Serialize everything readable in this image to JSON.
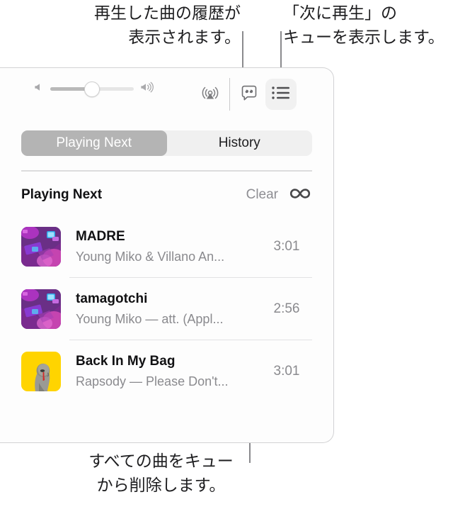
{
  "annotations": {
    "history_callout": "再生した曲の履歴が\n表示されます。",
    "queue_callout": "「次に再生」の\nキューを表示します。",
    "clear_callout": "すべての曲をキュー\nから削除します。"
  },
  "player": {
    "controls": {
      "volume_low_icon": "speaker-low-icon",
      "volume_high_icon": "speaker-high-icon",
      "volume_level_percent": 50,
      "airplay_icon": "airplay-icon",
      "lyrics_icon": "lyrics-speech-bubble-icon",
      "queue_icon": "queue-list-icon",
      "queue_active": true
    },
    "tabs": [
      {
        "label": "Playing Next",
        "active": true
      },
      {
        "label": "History",
        "active": false
      }
    ],
    "section": {
      "title": "Playing Next",
      "clear_label": "Clear",
      "autoplay_icon": "infinity-autoplay-icon"
    },
    "tracks": [
      {
        "title": "MADRE",
        "subtitle": "Young Miko & Villano An...",
        "duration": "3:01",
        "artwork": "purple-room-artwork"
      },
      {
        "title": "tamagotchi",
        "subtitle": "Young Miko — att. (Appl...",
        "duration": "2:56",
        "artwork": "purple-room-artwork"
      },
      {
        "title": "Back In My Bag",
        "subtitle": "Rapsody — Please Don't...",
        "duration": "3:01",
        "artwork": "yellow-portrait-artwork"
      }
    ]
  },
  "colors": {
    "panel_background": "#fdfdfd",
    "tab_active_background": "#b4b4b4",
    "queue_button_background": "#f1f1f1",
    "secondary_text": "#8a8a8e",
    "leader_line": "#8a8a8d"
  }
}
